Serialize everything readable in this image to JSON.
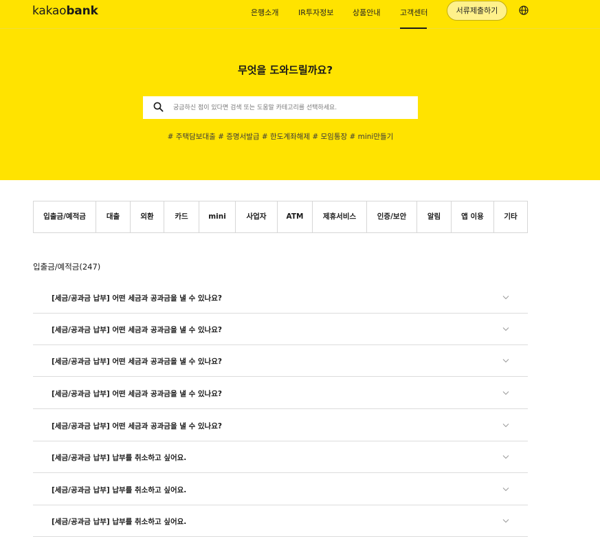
{
  "header": {
    "logo_light": "kakao",
    "logo_bold": "bank",
    "nav": [
      "은행소개",
      "IR투자정보",
      "상품안내",
      "고객센터"
    ],
    "active_nav": "고객센터",
    "submit_label": "서류제출하기",
    "language_icon": "globe-icon"
  },
  "hero": {
    "title": "무엇을 도와드릴까요?",
    "search_placeholder": "궁금하신 점이 있다면 검색 또는 도움말 카테고리를 선택하세요.",
    "search_icon": "search-icon",
    "tags": [
      "# 주택담보대출",
      "# 증명서발급",
      "# 한도계좌해제",
      "# 모임통장",
      "# mini만들기"
    ]
  },
  "categories": [
    "입출금/예적금",
    "대출",
    "외환",
    "카드",
    "mini",
    "사업자",
    "ATM",
    "제휴서비스",
    "인증/보안",
    "알림",
    "앱 이용",
    "기타"
  ],
  "faq": {
    "section_title": "입출금/예적금(247)",
    "items": [
      "[세금/공과금 납부] 어떤 세금과 공과금을 낼 수 있나요?",
      "[세금/공과금 납부] 어떤 세금과 공과금을 낼 수 있나요?",
      "[세금/공과금 납부] 어떤 세금과 공과금을 낼 수 있나요?",
      "[세금/공과금 납부] 어떤 세금과 공과금을 낼 수 있나요?",
      "[세금/공과금 납부] 어떤 세금과 공과금을 낼 수 있나요?",
      "[세금/공과금 납부] 납부를 취소하고 싶어요.",
      "[세금/공과금 납부] 납부를 취소하고 싶어요.",
      "[세금/공과금 납부] 납부를 취소하고 싶어요."
    ],
    "chevron_icon": "chevron-down-icon"
  },
  "colors": {
    "brand_yellow": "#ffe300",
    "text": "#1a1a1a",
    "border": "#d6d6d6"
  }
}
